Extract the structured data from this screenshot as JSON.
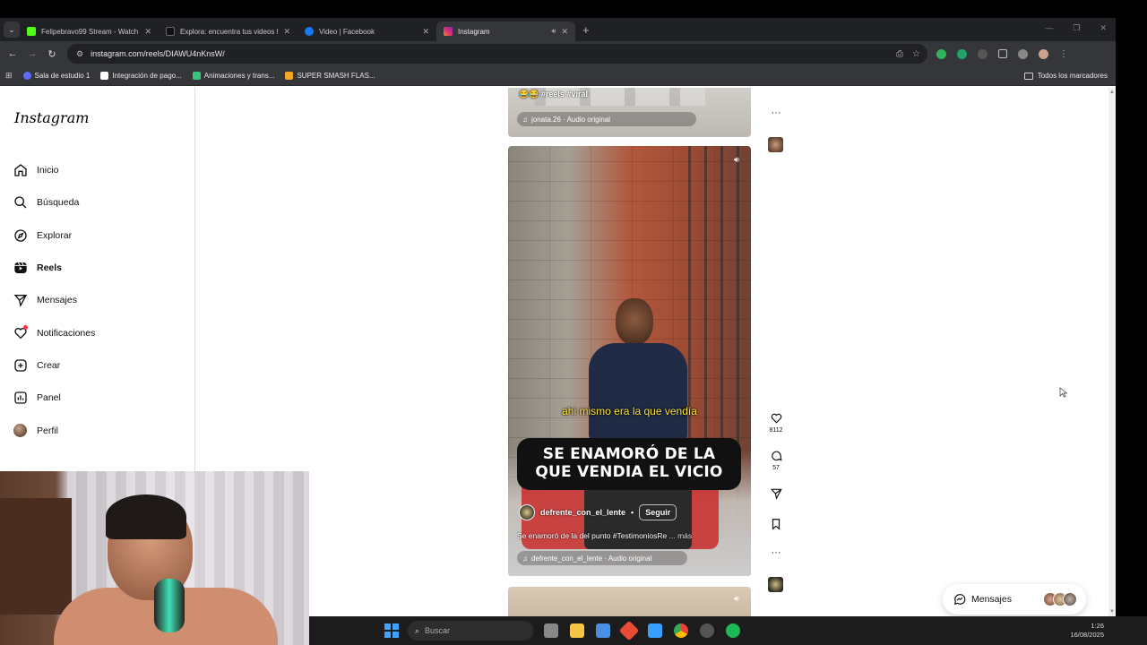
{
  "browser": {
    "tabs": [
      {
        "title": "Felipebravo99 Stream - Watch",
        "favicon_color": "#53fc18",
        "active": false
      },
      {
        "title": "Explora: encuentra tus videos fa",
        "favicon_color": "#111111",
        "active": false
      },
      {
        "title": "Video | Facebook",
        "favicon_color": "#1877f2",
        "active": false
      },
      {
        "title": "Instagram",
        "favicon_color": "#e1306c",
        "active": true
      }
    ],
    "url": "instagram.com/reels/DIAWU4nKnsW/",
    "bookmarks": [
      {
        "label": "Sala de estudio 1",
        "color": "#5a6cff"
      },
      {
        "label": "Integración de pago...",
        "color": "#ffffff"
      },
      {
        "label": "Animaciones y trans...",
        "color": "#3cc47c"
      },
      {
        "label": "SUPER SMASH FLAS...",
        "color": "#f5a623"
      }
    ],
    "all_bookmarks": "Todos los marcadores"
  },
  "instagram": {
    "logo": "Instagram",
    "menu": [
      {
        "label": "Inicio",
        "icon": "home-icon"
      },
      {
        "label": "Búsqueda",
        "icon": "search-icon"
      },
      {
        "label": "Explorar",
        "icon": "compass-icon"
      },
      {
        "label": "Reels",
        "icon": "reels-icon",
        "active": true
      },
      {
        "label": "Mensajes",
        "icon": "send-icon"
      },
      {
        "label": "Notificaciones",
        "icon": "heart-icon",
        "badge": true
      },
      {
        "label": "Crear",
        "icon": "plus-square-icon"
      },
      {
        "label": "Panel",
        "icon": "chart-icon"
      },
      {
        "label": "Perfil",
        "icon": "avatar-icon"
      }
    ],
    "prev_reel": {
      "tags": "😂😂 #reels #viral",
      "audio": "jonata.26 · Audio original"
    },
    "reel": {
      "subtitle": "ahi mismo era la que vendía",
      "headline_line1": "SE ENAMORÓ DE LA",
      "headline_line2": "QUE VENDIA EL VICIO",
      "author": "defrente_con_el_lente",
      "separator": "•",
      "follow": "Seguir",
      "caption": "Se enamoró de la del punto #TestimoniosRe",
      "caption_more": "... más",
      "audio": "defrente_con_el_lente · Audio original",
      "likes": "8112",
      "comments": "57"
    },
    "messages_label": "Mensajes"
  },
  "taskbar": {
    "search_placeholder": "Buscar",
    "time": "1:26",
    "date": "16/08/2025"
  }
}
